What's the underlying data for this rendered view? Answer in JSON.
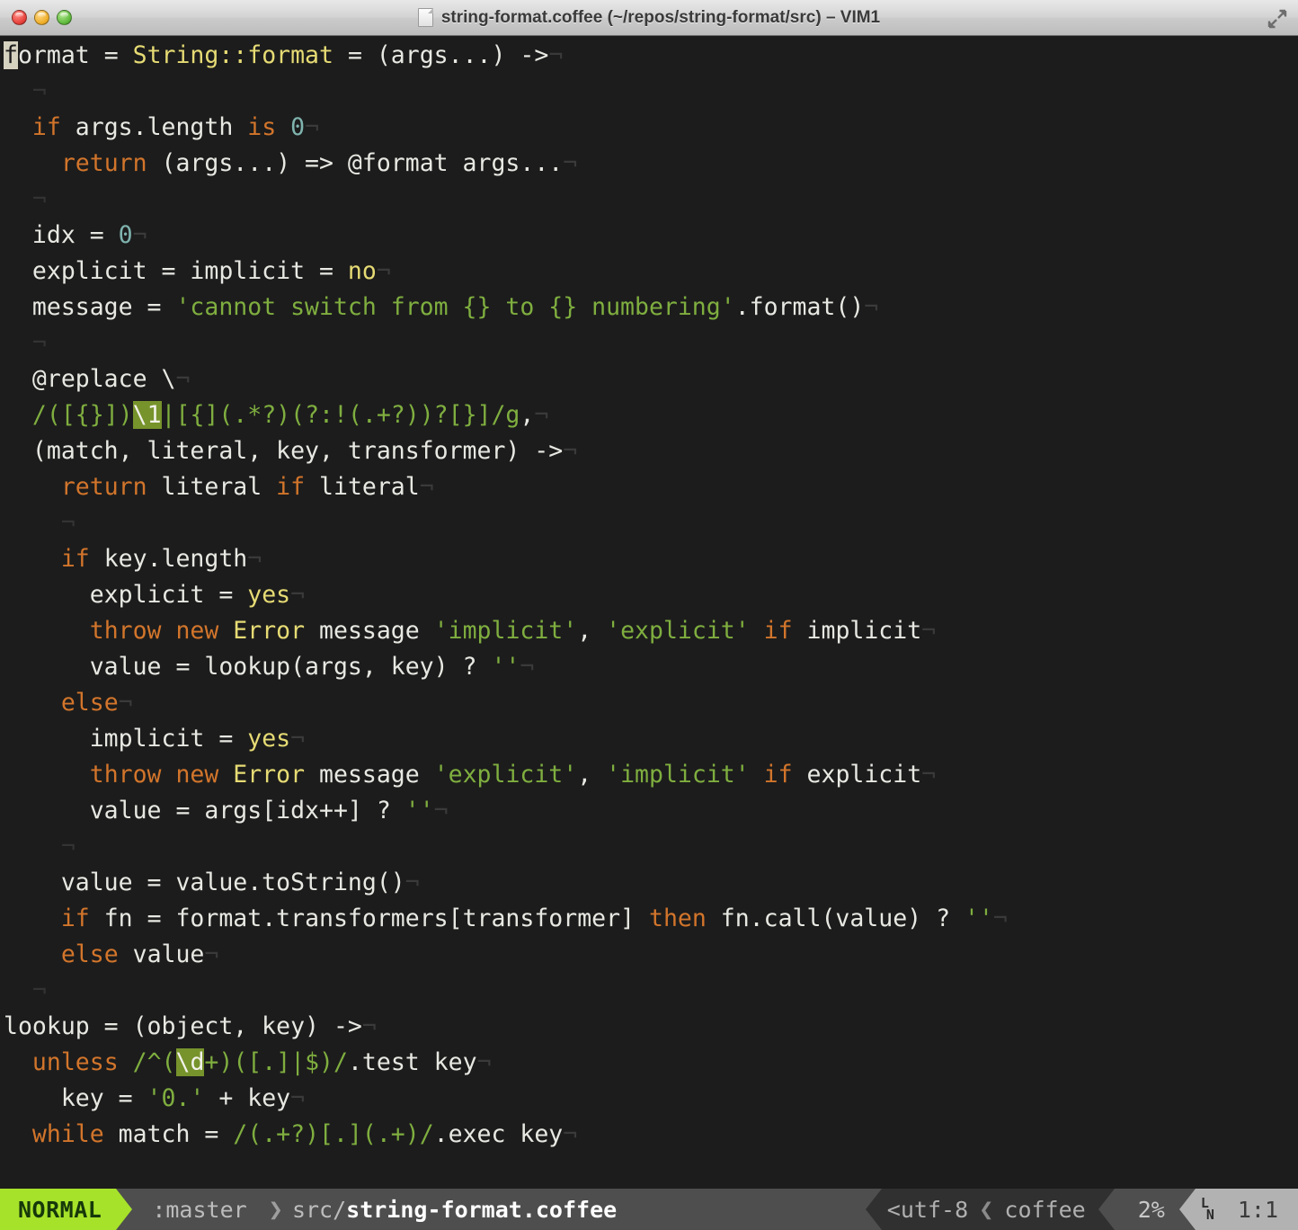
{
  "window": {
    "title": "string-format.coffee (~/repos/string-format/src) – VIM1",
    "traffic_lights": [
      "close",
      "minimize",
      "zoom"
    ],
    "fullscreen_icon": "fullscreen-expand-icon",
    "doc_icon": "document-icon"
  },
  "editor": {
    "filetype": "coffee",
    "cursor_char": "f",
    "eol_glyph": "¬",
    "colors": {
      "background": "#1c1c1c",
      "foreground": "#e8e8e3",
      "keyword": "#d2752b",
      "function": "#e6db74",
      "string": "#7fae3f",
      "number": "#7fb3ae",
      "search_highlight_bg": "#77932c",
      "cursor_bg": "#d6d2c0",
      "eol_marker": "#3a3a3a"
    },
    "lines": [
      {
        "n": 1,
        "tokens": [
          {
            "t": "f",
            "c": "cursor"
          },
          {
            "t": "ormat = ",
            "c": "plain"
          },
          {
            "t": "String::format",
            "c": "fn"
          },
          {
            "t": " = (args...) ->",
            "c": "plain"
          },
          {
            "t": "¬",
            "c": "eol"
          }
        ]
      },
      {
        "n": 2,
        "tokens": [
          {
            "t": "  ",
            "c": "plain"
          },
          {
            "t": "¬",
            "c": "indent"
          }
        ]
      },
      {
        "n": 3,
        "tokens": [
          {
            "t": "  ",
            "c": "plain"
          },
          {
            "t": "if",
            "c": "kw"
          },
          {
            "t": " args.length ",
            "c": "plain"
          },
          {
            "t": "is",
            "c": "kw"
          },
          {
            "t": " ",
            "c": "plain"
          },
          {
            "t": "0",
            "c": "num"
          },
          {
            "t": "¬",
            "c": "eol"
          }
        ]
      },
      {
        "n": 4,
        "tokens": [
          {
            "t": "    ",
            "c": "plain"
          },
          {
            "t": "return",
            "c": "kw"
          },
          {
            "t": " (args...) => @format args...",
            "c": "plain"
          },
          {
            "t": "¬",
            "c": "eol"
          }
        ]
      },
      {
        "n": 5,
        "tokens": [
          {
            "t": "  ",
            "c": "plain"
          },
          {
            "t": "¬",
            "c": "indent"
          }
        ]
      },
      {
        "n": 6,
        "tokens": [
          {
            "t": "  idx = ",
            "c": "plain"
          },
          {
            "t": "0",
            "c": "num"
          },
          {
            "t": "¬",
            "c": "eol"
          }
        ]
      },
      {
        "n": 7,
        "tokens": [
          {
            "t": "  explicit = implicit = ",
            "c": "plain"
          },
          {
            "t": "no",
            "c": "const"
          },
          {
            "t": "¬",
            "c": "eol"
          }
        ]
      },
      {
        "n": 8,
        "tokens": [
          {
            "t": "  message = ",
            "c": "plain"
          },
          {
            "t": "'cannot switch from {} to {} numbering'",
            "c": "str"
          },
          {
            "t": ".format()",
            "c": "plain"
          },
          {
            "t": "¬",
            "c": "eol"
          }
        ]
      },
      {
        "n": 9,
        "tokens": [
          {
            "t": "  ",
            "c": "plain"
          },
          {
            "t": "¬",
            "c": "indent"
          }
        ]
      },
      {
        "n": 10,
        "tokens": [
          {
            "t": "  @replace \\",
            "c": "plain"
          },
          {
            "t": "¬",
            "c": "eol"
          }
        ]
      },
      {
        "n": 11,
        "tokens": [
          {
            "t": "  ",
            "c": "plain"
          },
          {
            "t": "/([{}])",
            "c": "str"
          },
          {
            "t": "\\1",
            "c": "hl"
          },
          {
            "t": "|[{](.*?)(?:!(.+?))?[}]/g",
            "c": "str"
          },
          {
            "t": ",",
            "c": "plain"
          },
          {
            "t": "¬",
            "c": "eol"
          }
        ]
      },
      {
        "n": 12,
        "tokens": [
          {
            "t": "  (match, literal, key, transformer) ->",
            "c": "plain"
          },
          {
            "t": "¬",
            "c": "eol"
          }
        ]
      },
      {
        "n": 13,
        "tokens": [
          {
            "t": "    ",
            "c": "plain"
          },
          {
            "t": "return",
            "c": "kw"
          },
          {
            "t": " literal ",
            "c": "plain"
          },
          {
            "t": "if",
            "c": "kw"
          },
          {
            "t": " literal",
            "c": "plain"
          },
          {
            "t": "¬",
            "c": "eol"
          }
        ]
      },
      {
        "n": 14,
        "tokens": [
          {
            "t": "    ",
            "c": "plain"
          },
          {
            "t": "¬",
            "c": "indent"
          }
        ]
      },
      {
        "n": 15,
        "tokens": [
          {
            "t": "    ",
            "c": "plain"
          },
          {
            "t": "if",
            "c": "kw"
          },
          {
            "t": " key.length",
            "c": "plain"
          },
          {
            "t": "¬",
            "c": "eol"
          }
        ]
      },
      {
        "n": 16,
        "tokens": [
          {
            "t": "      explicit = ",
            "c": "plain"
          },
          {
            "t": "yes",
            "c": "const"
          },
          {
            "t": "¬",
            "c": "eol"
          }
        ]
      },
      {
        "n": 17,
        "tokens": [
          {
            "t": "      ",
            "c": "plain"
          },
          {
            "t": "throw new",
            "c": "kw"
          },
          {
            "t": " ",
            "c": "plain"
          },
          {
            "t": "Error",
            "c": "fn"
          },
          {
            "t": " message ",
            "c": "plain"
          },
          {
            "t": "'implicit'",
            "c": "str"
          },
          {
            "t": ", ",
            "c": "plain"
          },
          {
            "t": "'explicit'",
            "c": "str"
          },
          {
            "t": " ",
            "c": "plain"
          },
          {
            "t": "if",
            "c": "kw"
          },
          {
            "t": " implicit",
            "c": "plain"
          },
          {
            "t": "¬",
            "c": "eol"
          }
        ]
      },
      {
        "n": 18,
        "tokens": [
          {
            "t": "      value = lookup(args, key) ? ",
            "c": "plain"
          },
          {
            "t": "''",
            "c": "str"
          },
          {
            "t": "¬",
            "c": "eol"
          }
        ]
      },
      {
        "n": 19,
        "tokens": [
          {
            "t": "    ",
            "c": "plain"
          },
          {
            "t": "else",
            "c": "kw"
          },
          {
            "t": "¬",
            "c": "eol"
          }
        ]
      },
      {
        "n": 20,
        "tokens": [
          {
            "t": "      implicit = ",
            "c": "plain"
          },
          {
            "t": "yes",
            "c": "const"
          },
          {
            "t": "¬",
            "c": "eol"
          }
        ]
      },
      {
        "n": 21,
        "tokens": [
          {
            "t": "      ",
            "c": "plain"
          },
          {
            "t": "throw new",
            "c": "kw"
          },
          {
            "t": " ",
            "c": "plain"
          },
          {
            "t": "Error",
            "c": "fn"
          },
          {
            "t": " message ",
            "c": "plain"
          },
          {
            "t": "'explicit'",
            "c": "str"
          },
          {
            "t": ", ",
            "c": "plain"
          },
          {
            "t": "'implicit'",
            "c": "str"
          },
          {
            "t": " ",
            "c": "plain"
          },
          {
            "t": "if",
            "c": "kw"
          },
          {
            "t": " explicit",
            "c": "plain"
          },
          {
            "t": "¬",
            "c": "eol"
          }
        ]
      },
      {
        "n": 22,
        "tokens": [
          {
            "t": "      value = args[idx++] ? ",
            "c": "plain"
          },
          {
            "t": "''",
            "c": "str"
          },
          {
            "t": "¬",
            "c": "eol"
          }
        ]
      },
      {
        "n": 23,
        "tokens": [
          {
            "t": "    ",
            "c": "plain"
          },
          {
            "t": "¬",
            "c": "indent"
          }
        ]
      },
      {
        "n": 24,
        "tokens": [
          {
            "t": "    value = value.toString()",
            "c": "plain"
          },
          {
            "t": "¬",
            "c": "eol"
          }
        ]
      },
      {
        "n": 25,
        "tokens": [
          {
            "t": "    ",
            "c": "plain"
          },
          {
            "t": "if",
            "c": "kw"
          },
          {
            "t": " fn = format.transformers[transformer] ",
            "c": "plain"
          },
          {
            "t": "then",
            "c": "kw"
          },
          {
            "t": " fn.call(value) ? ",
            "c": "plain"
          },
          {
            "t": "''",
            "c": "str"
          },
          {
            "t": "¬",
            "c": "eol"
          }
        ]
      },
      {
        "n": 26,
        "tokens": [
          {
            "t": "    ",
            "c": "plain"
          },
          {
            "t": "else",
            "c": "kw"
          },
          {
            "t": " value",
            "c": "plain"
          },
          {
            "t": "¬",
            "c": "eol"
          }
        ]
      },
      {
        "n": 27,
        "tokens": [
          {
            "t": "  ",
            "c": "plain"
          },
          {
            "t": "¬",
            "c": "indent"
          }
        ]
      },
      {
        "n": 28,
        "tokens": [
          {
            "t": "lookup = (object, key) ->",
            "c": "plain"
          },
          {
            "t": "¬",
            "c": "eol"
          }
        ]
      },
      {
        "n": 29,
        "tokens": [
          {
            "t": "  ",
            "c": "plain"
          },
          {
            "t": "unless",
            "c": "kw"
          },
          {
            "t": " ",
            "c": "plain"
          },
          {
            "t": "/^(",
            "c": "str"
          },
          {
            "t": "\\d",
            "c": "hl"
          },
          {
            "t": "+)([.]|$)/",
            "c": "str"
          },
          {
            "t": ".test key",
            "c": "plain"
          },
          {
            "t": "¬",
            "c": "eol"
          }
        ]
      },
      {
        "n": 30,
        "tokens": [
          {
            "t": "    key = ",
            "c": "plain"
          },
          {
            "t": "'0.'",
            "c": "str"
          },
          {
            "t": " + key",
            "c": "plain"
          },
          {
            "t": "¬",
            "c": "eol"
          }
        ]
      },
      {
        "n": 31,
        "tokens": [
          {
            "t": "  ",
            "c": "plain"
          },
          {
            "t": "while",
            "c": "kw"
          },
          {
            "t": " match = ",
            "c": "plain"
          },
          {
            "t": "/(.+?)[.](.+)/",
            "c": "str"
          },
          {
            "t": ".exec key",
            "c": "plain"
          },
          {
            "t": "¬",
            "c": "eol"
          }
        ]
      }
    ]
  },
  "statusbar": {
    "mode": "NORMAL",
    "branch": ":master",
    "branch_separator": "❯",
    "file_dir": "src/",
    "file_name": "string-format.coffee",
    "encoding_marker": "<",
    "encoding": "utf-8",
    "encoding_separator": "❮",
    "filetype": "coffee",
    "percent": "2%",
    "line_col_glyph_top": "L",
    "line_col_glyph_bottom": "N",
    "position": "1:1",
    "colors": {
      "mode_bg": "#a6e22a",
      "mode_fg": "#16380a",
      "mid_bg": "#4e4e4e",
      "dark_bg": "#303030",
      "light_bg": "#b2b2b2"
    }
  }
}
